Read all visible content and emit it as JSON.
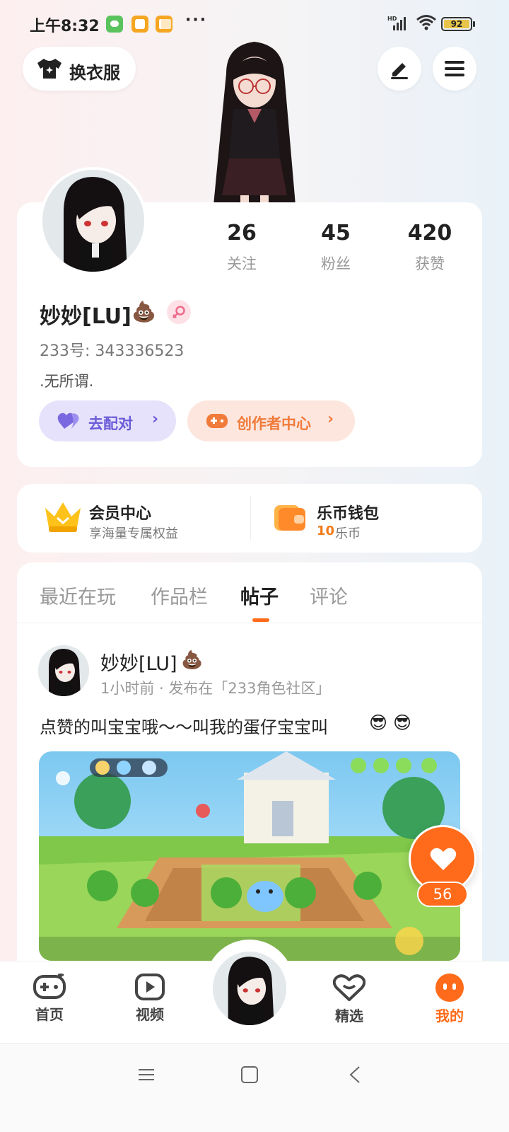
{
  "status_bar": {
    "time": "上午8:32",
    "more": "···",
    "network": "HD",
    "battery": "92"
  },
  "header": {
    "outfit_label": "换衣服"
  },
  "profile": {
    "stats": [
      {
        "value": "26",
        "label": "关注"
      },
      {
        "value": "45",
        "label": "粉丝"
      },
      {
        "value": "420",
        "label": "获赞"
      }
    ],
    "name": "妙妙[LU]",
    "id_line": "233号: 343336523",
    "bio": ".无所谓.",
    "match_label": "去配对",
    "creator_label": "创作者中心"
  },
  "services": {
    "vip_title": "会员中心",
    "vip_sub": "享海量专属权益",
    "wallet_title": "乐币钱包",
    "wallet_amount": "10",
    "wallet_unit": "乐币"
  },
  "tabs": [
    "最近在玩",
    "作品栏",
    "帖子",
    "评论"
  ],
  "active_tab": "帖子",
  "post": {
    "author": "妙妙[LU]",
    "meta": "1小时前 · 发布在「233角色社区」",
    "text": "点赞的叫宝宝哦～～叫我的蛋仔宝宝叫",
    "like_count": "56"
  },
  "bottom_nav": [
    {
      "label": "首页",
      "icon": "gamepad-icon"
    },
    {
      "label": "视频",
      "icon": "video-play-icon"
    },
    {
      "label": "精选",
      "icon": "heart-chat-icon"
    },
    {
      "label": "我的",
      "icon": "face-icon"
    }
  ],
  "colors": {
    "accent": "#ff6b1a",
    "match_bg": "#e6e2fb",
    "creator_bg": "#fde6de"
  }
}
